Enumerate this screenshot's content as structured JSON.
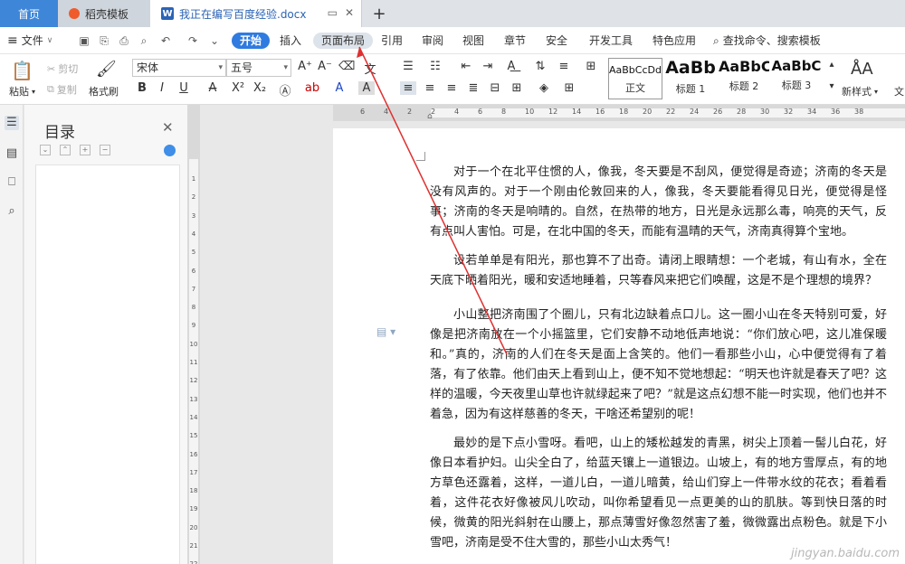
{
  "tabs": {
    "home": "首页",
    "shell": "稻壳模板",
    "doc": "我正在编写百度经验.docx",
    "add": "+"
  },
  "menu": {
    "file": "文件",
    "items": [
      "开始",
      "插入",
      "页面布局",
      "引用",
      "审阅",
      "视图",
      "章节",
      "安全",
      "开发工具",
      "特色应用"
    ],
    "active": "开始",
    "highlighted": "页面布局",
    "search": "查找命令、搜索模板"
  },
  "ribbon": {
    "paste": "粘贴",
    "cut": "剪切",
    "copy": "复制",
    "format_painter": "格式刷",
    "font_name": "宋体",
    "font_size": "五号",
    "styles": [
      {
        "sample": "AaBbCcDd",
        "label": "正文"
      },
      {
        "sample": "AaBb",
        "label": "标题 1"
      },
      {
        "sample": "AaBbC",
        "label": "标题 2"
      },
      {
        "sample": "AaBbC",
        "label": "标题 3"
      }
    ],
    "new_style": "新样式",
    "more": "文"
  },
  "ruler_numbers": [
    "6",
    "4",
    "2",
    "2",
    "4",
    "6",
    "8",
    "10",
    "12",
    "14",
    "16",
    "18",
    "20",
    "22",
    "24",
    "26",
    "28",
    "30",
    "32",
    "34",
    "36",
    "38"
  ],
  "vruler_numbers": [
    "1",
    "2",
    "3",
    "4",
    "5",
    "6",
    "7",
    "8",
    "9",
    "10",
    "11",
    "12",
    "13",
    "14",
    "15",
    "16",
    "17",
    "18",
    "19",
    "20",
    "21",
    "22",
    "23"
  ],
  "toc": {
    "title": "目录"
  },
  "document": {
    "paragraphs": [
      "对于一个在北平住惯的人，像我，冬天要是不刮风，便觉得是奇迹；济南的冬天是没有风声的。对于一个刚由伦敦回来的人，像我，冬天要能看得见日光，便觉得是怪事；济南的冬天是响晴的。自然，在热带的地方，日光是永远那么毒，响亮的天气，反有点叫人害怕。可是，在北中国的冬天，而能有温晴的天气，济南真得算个宝地。",
      "设若单单是有阳光，那也算不了出奇。请闭上眼睛想：一个老城，有山有水，全在天底下晒着阳光，暖和安适地睡着，只等春风来把它们唤醒，这是不是个理想的境界？",
      "小山整把济南围了个圈儿，只有北边缺着点口儿。这一圈小山在冬天特别可爱，好像是把济南放在一个小摇篮里，它们安静不动地低声地说：“你们放心吧，这儿准保暖和。”真的，济南的人们在冬天是面上含笑的。他们一看那些小山，心中便觉得有了着落，有了依靠。他们由天上看到山上，便不知不觉地想起：“明天也许就是春天了吧？这样的温暖，今天夜里山草也许就绿起来了吧？”就是这点幻想不能一时实现，他们也并不着急，因为有这样慈善的冬天，干啥还希望别的呢！",
      "最妙的是下点小雪呀。看吧，山上的矮松越发的青黑，树尖上顶着一髻儿白花，好像日本看护妇。山尖全白了，给蓝天镶上一道银边。山坡上，有的地方雪厚点，有的地方草色还露着，这样，一道儿白，一道儿暗黄，给山们穿上一件带水纹的花衣；看着看着，这件花衣好像被风儿吹动，叫你希望看见一点更美的山的肌肤。等到快日落的时候，微黄的阳光斜射在山腰上，那点薄雪好像忽然害了羞，微微露出点粉色。就是下小雪吧，济南是受不住大雪的，那些小山太秀气！"
    ]
  },
  "watermark": "jingyan.baidu.com",
  "colors": {
    "accent": "#2f7be0",
    "home_tab": "#3e86d8",
    "annotation_arrow": "#e03030"
  }
}
